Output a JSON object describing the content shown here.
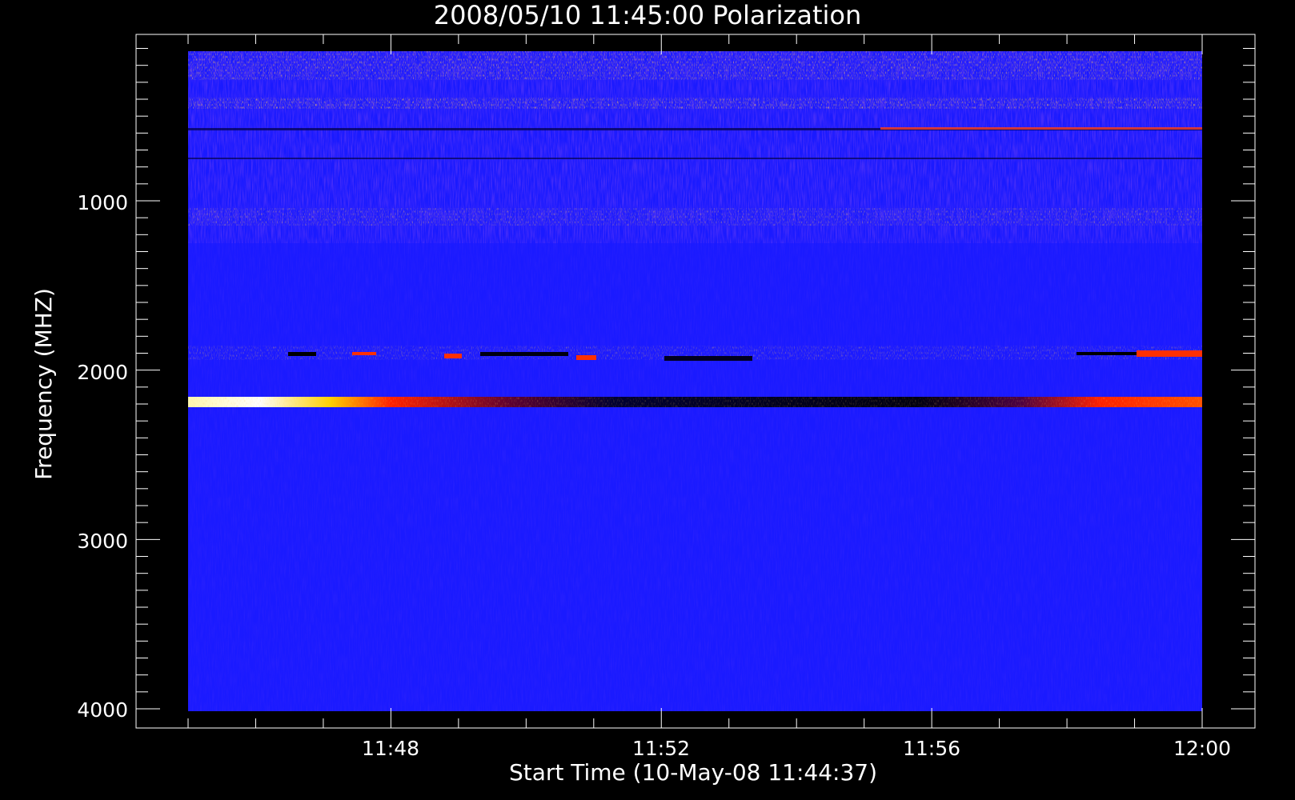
{
  "chart_data": {
    "type": "heatmap",
    "title": "2008/05/10 11:45:00 Polarization",
    "xlabel": "Start Time (10-May-08 11:44:37)",
    "ylabel": "Frequency (MHZ)",
    "x_ticks": [
      "11:48",
      "11:52",
      "11:56",
      "12:00"
    ],
    "y_ticks": [
      "1000",
      "2000",
      "3000",
      "4000"
    ],
    "x_range": [
      "11:45:00",
      "12:00:00"
    ],
    "y_range": [
      100,
      4020
    ],
    "y_inverted": true,
    "colormap": [
      "#000000",
      "#0000ff",
      "#ff0000",
      "#ffff00",
      "#ffffff"
    ],
    "background_color": "#1a1aff",
    "bands": [
      {
        "freq_from": 100,
        "freq_to": 230,
        "level": "noisy-mixed"
      },
      {
        "freq_from": 190,
        "freq_to": 230,
        "level": "red-yellow speckle"
      },
      {
        "freq_from": 370,
        "freq_to": 420,
        "level": "red-yellow speckle"
      },
      {
        "freq_from": 1050,
        "freq_to": 1150,
        "level": "red speckle"
      },
      {
        "freq_from": 1870,
        "freq_to": 1900,
        "level": "red/black segments"
      },
      {
        "freq_from": 2170,
        "freq_to": 2220,
        "level": "bright yellow-white fading to red then black then red"
      }
    ]
  }
}
